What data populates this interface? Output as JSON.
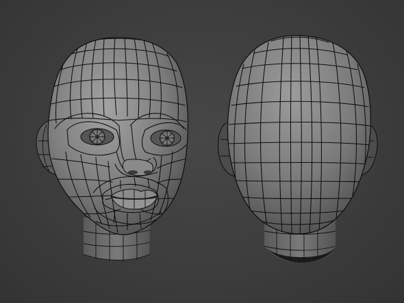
{
  "scene": {
    "background_color": "#3b3b3b",
    "mesh_color": "#7c7c7c",
    "wire_color": "#0d0d0d",
    "models": [
      {
        "name": "head-front-view",
        "view": "front"
      },
      {
        "name": "head-back-view",
        "view": "back"
      }
    ]
  }
}
